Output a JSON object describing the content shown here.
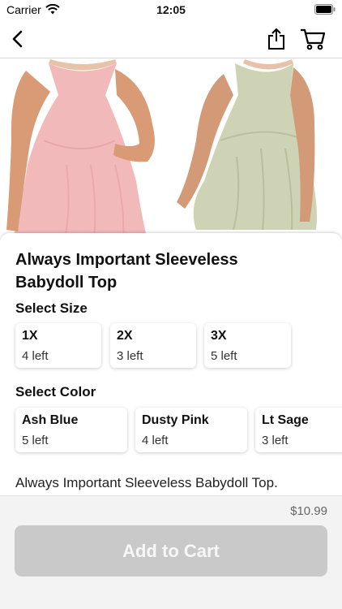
{
  "status_bar": {
    "carrier": "Carrier",
    "time": "12:05",
    "icons": [
      "wifi-icon",
      "battery-icon"
    ]
  },
  "nav": {
    "icons": [
      "back-chevron-icon",
      "share-icon",
      "cart-icon"
    ]
  },
  "gallery": {
    "images": [
      {
        "name": "pink-top-photo",
        "color": "#f2b9bb"
      },
      {
        "name": "sage-top-photo",
        "color": "#cdd3b4"
      }
    ]
  },
  "product": {
    "title": "Always Important Sleeveless Babydoll Top",
    "description": "Always Important Sleeveless Babydoll Top.",
    "price": "$10.99"
  },
  "sizes": {
    "heading": "Select Size",
    "options": [
      {
        "name": "1X",
        "stock": "4 left"
      },
      {
        "name": "2X",
        "stock": "3 left"
      },
      {
        "name": "3X",
        "stock": "5 left"
      }
    ]
  },
  "colors": {
    "heading": "Select Color",
    "options": [
      {
        "name": "Ash Blue",
        "stock": "5 left"
      },
      {
        "name": "Dusty Pink",
        "stock": "4 left"
      },
      {
        "name": "Lt Sage",
        "stock": "3 left"
      }
    ]
  },
  "cart": {
    "button_label": "Add to Cart",
    "button_color": "#c9c9c9"
  }
}
